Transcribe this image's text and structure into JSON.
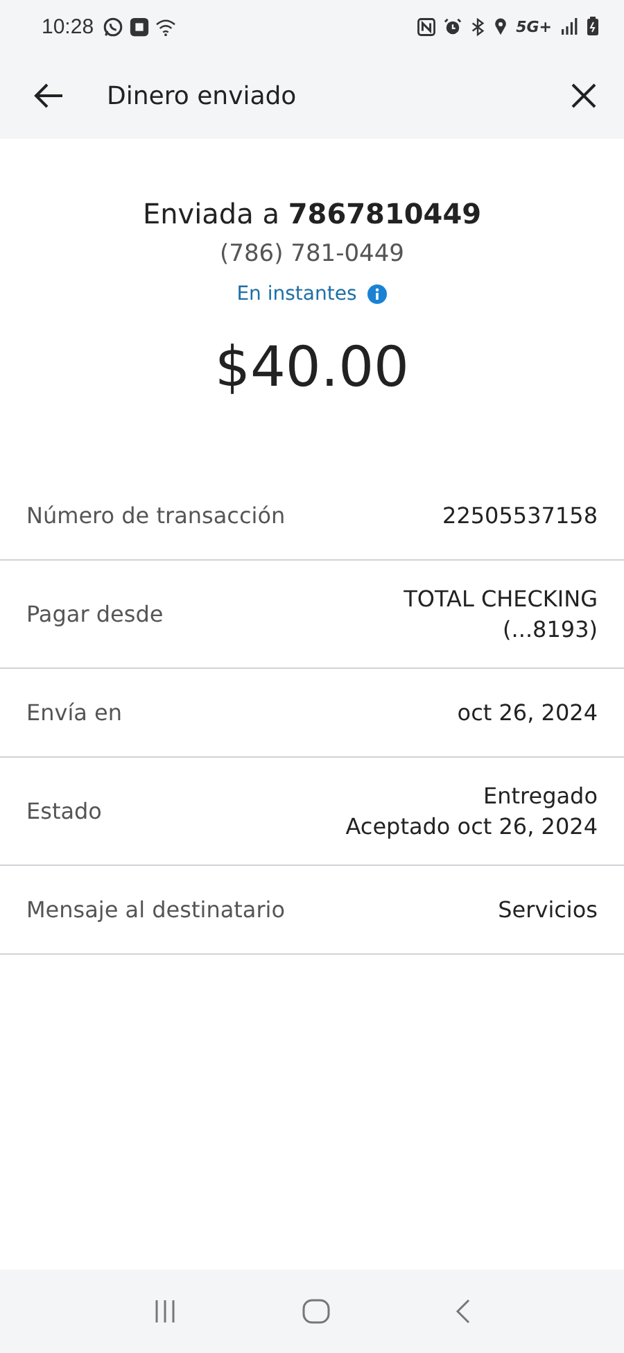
{
  "status_bar": {
    "time": "10:28",
    "network": "5G+"
  },
  "header": {
    "title": "Dinero enviado"
  },
  "summary": {
    "sent_to_prefix": "Enviada a ",
    "sent_to_number": "7867810449",
    "phone": "(786) 781-0449",
    "speed": "En instantes",
    "amount": "$40.00"
  },
  "details": [
    {
      "label": "Número de transacción",
      "value": [
        "22505537158"
      ]
    },
    {
      "label": "Pagar desde",
      "value": [
        "TOTAL CHECKING",
        "(...8193)"
      ]
    },
    {
      "label": "Envía en",
      "value": [
        "oct 26, 2024"
      ]
    },
    {
      "label": "Estado",
      "value": [
        "Entregado",
        "Aceptado oct 26, 2024"
      ]
    },
    {
      "label": "Mensaje al destinatario",
      "value": [
        "Servicios"
      ]
    }
  ]
}
